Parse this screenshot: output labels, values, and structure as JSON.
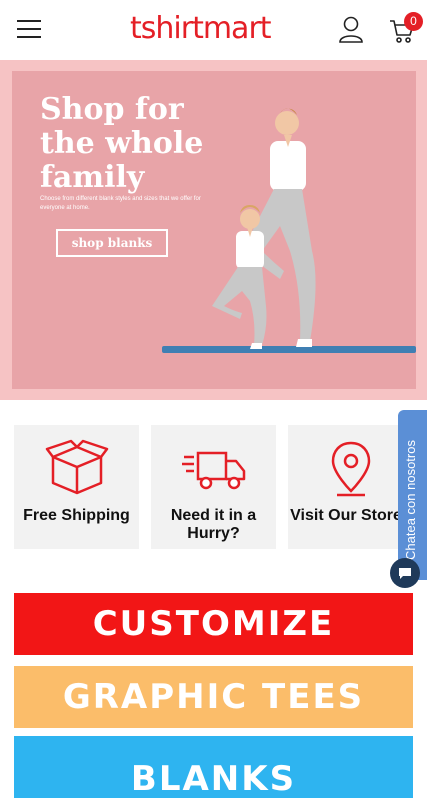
{
  "header": {
    "logo_text": "tshirtmart",
    "cart_count": "0"
  },
  "hero": {
    "title": "Shop for the whole family",
    "subtitle": "Choose from different blank styles and sizes that we offer for everyone at home.",
    "button_label": "shop blanks",
    "slides": 3,
    "active_slide": 2
  },
  "features": [
    {
      "label": "Free Shipping",
      "icon": "box-icon"
    },
    {
      "label": "Need it in a Hurry?",
      "icon": "truck-icon"
    },
    {
      "label": "Visit Our Stores",
      "icon": "location-pin-icon"
    }
  ],
  "chat": {
    "label": "Chatea con nosotros"
  },
  "banners": [
    {
      "label": "CUSTOMIZE",
      "color": "#f21616"
    },
    {
      "label": "GRAPHIC TEES",
      "color": "#fbbd6a"
    },
    {
      "label": "BLANKS",
      "color": "#2eb4f0"
    }
  ],
  "colors": {
    "brand": "#e41f26",
    "hero_bg": "#e8a4a8",
    "chat": "#5b8fd6"
  }
}
